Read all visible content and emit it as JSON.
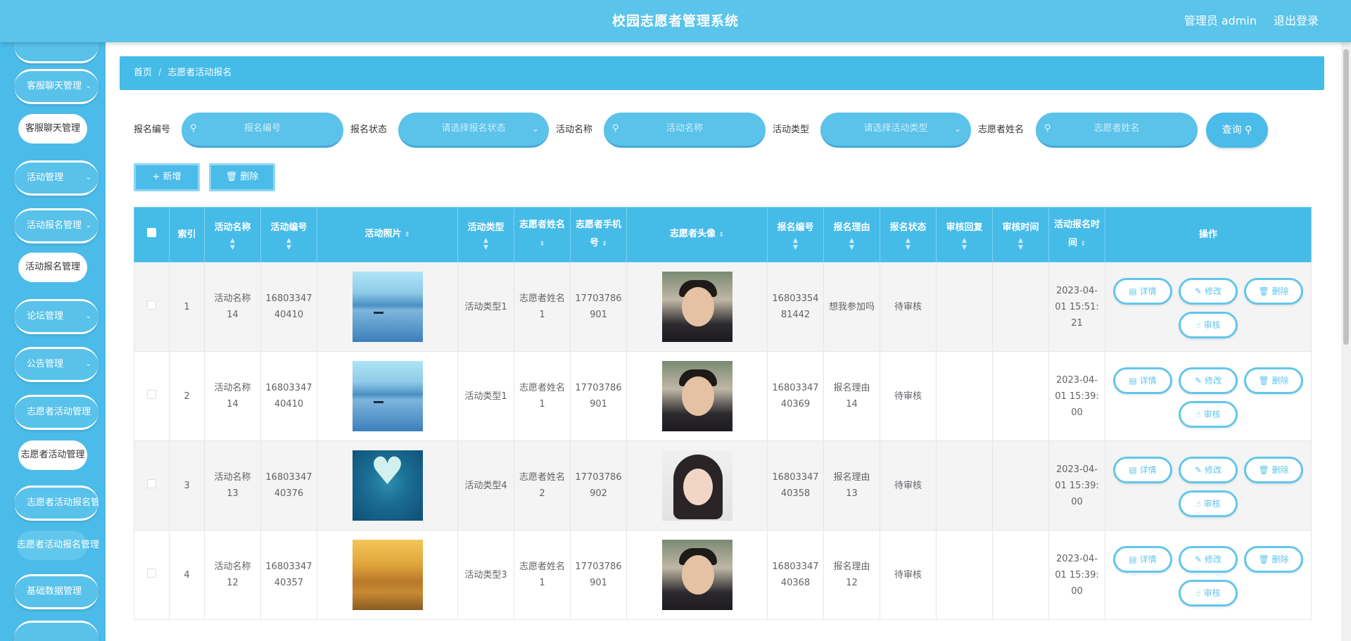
{
  "header": {
    "title": "校园志愿者管理系统",
    "user": "管理员 admin",
    "logout": "退出登录"
  },
  "sidebar": {
    "menus": [
      {
        "label": "客服聊天管理",
        "sub": "客服聊天管理"
      },
      {
        "label": "活动管理"
      },
      {
        "label": "活动报名管理",
        "sub": "活动报名管理"
      },
      {
        "label": "论坛管理"
      },
      {
        "label": "公告管理"
      },
      {
        "label": "志愿者活动管理",
        "sub": "志愿者活动管理"
      },
      {
        "label": "志愿者活动报名管理",
        "sub": "志愿者活动报名管理"
      },
      {
        "label": "基础数据管理"
      }
    ]
  },
  "breadcrumb": {
    "home": "首页",
    "current": "志愿者活动报名"
  },
  "search": {
    "label_no": "报名编号",
    "ph_no": "报名编号",
    "label_status": "报名状态",
    "ph_status": "请选择报名状态",
    "label_name": "活动名称",
    "ph_name": "活动名称",
    "label_type": "活动类型",
    "ph_type": "请选择活动类型",
    "label_vol": "志愿者姓名",
    "ph_vol": "志愿者姓名",
    "query": "查询"
  },
  "actions": {
    "add": "新增",
    "delete": "删除"
  },
  "table": {
    "headers": [
      "索引",
      "活动名称",
      "活动编号",
      "活动照片",
      "活动类型",
      "志愿者姓名",
      "志愿者手机号",
      "志愿者头像",
      "报名编号",
      "报名理由",
      "报名状态",
      "审核回复",
      "审核时间",
      "活动报名时间",
      "操作"
    ],
    "op_labels": {
      "detail": "详情",
      "edit": "修改",
      "delete": "删除",
      "audit": "审核"
    },
    "rows": [
      {
        "index": "1",
        "name": "活动名称14",
        "code": "1680334740410",
        "photo": "lake",
        "type": "活动类型1",
        "vol": "志愿者姓名1",
        "phone": "17703786901",
        "avatar": "male",
        "no": "1680335481442",
        "reason": "想我参加吗",
        "status": "待审核",
        "reply": "",
        "audit_time": "",
        "time": "2023-04-01 15:51:21"
      },
      {
        "index": "2",
        "name": "活动名称14",
        "code": "1680334740410",
        "photo": "lake",
        "type": "活动类型1",
        "vol": "志愿者姓名1",
        "phone": "17703786901",
        "avatar": "male",
        "no": "1680334740369",
        "reason": "报名理由14",
        "status": "待审核",
        "reply": "",
        "audit_time": "",
        "time": "2023-04-01 15:39:00"
      },
      {
        "index": "3",
        "name": "活动名称13",
        "code": "1680334740376",
        "photo": "heart",
        "type": "活动类型4",
        "vol": "志愿者姓名2",
        "phone": "17703786902",
        "avatar": "female",
        "no": "1680334740358",
        "reason": "报名理由13",
        "status": "待审核",
        "reply": "",
        "audit_time": "",
        "time": "2023-04-01 15:39:00"
      },
      {
        "index": "4",
        "name": "活动名称12",
        "code": "1680334740357",
        "photo": "autumn",
        "type": "活动类型3",
        "vol": "志愿者姓名1",
        "phone": "17703786901",
        "avatar": "male",
        "no": "1680334740368",
        "reason": "报名理由12",
        "status": "待审核",
        "reply": "",
        "audit_time": "",
        "time": "2023-04-01 15:39:00"
      }
    ]
  }
}
